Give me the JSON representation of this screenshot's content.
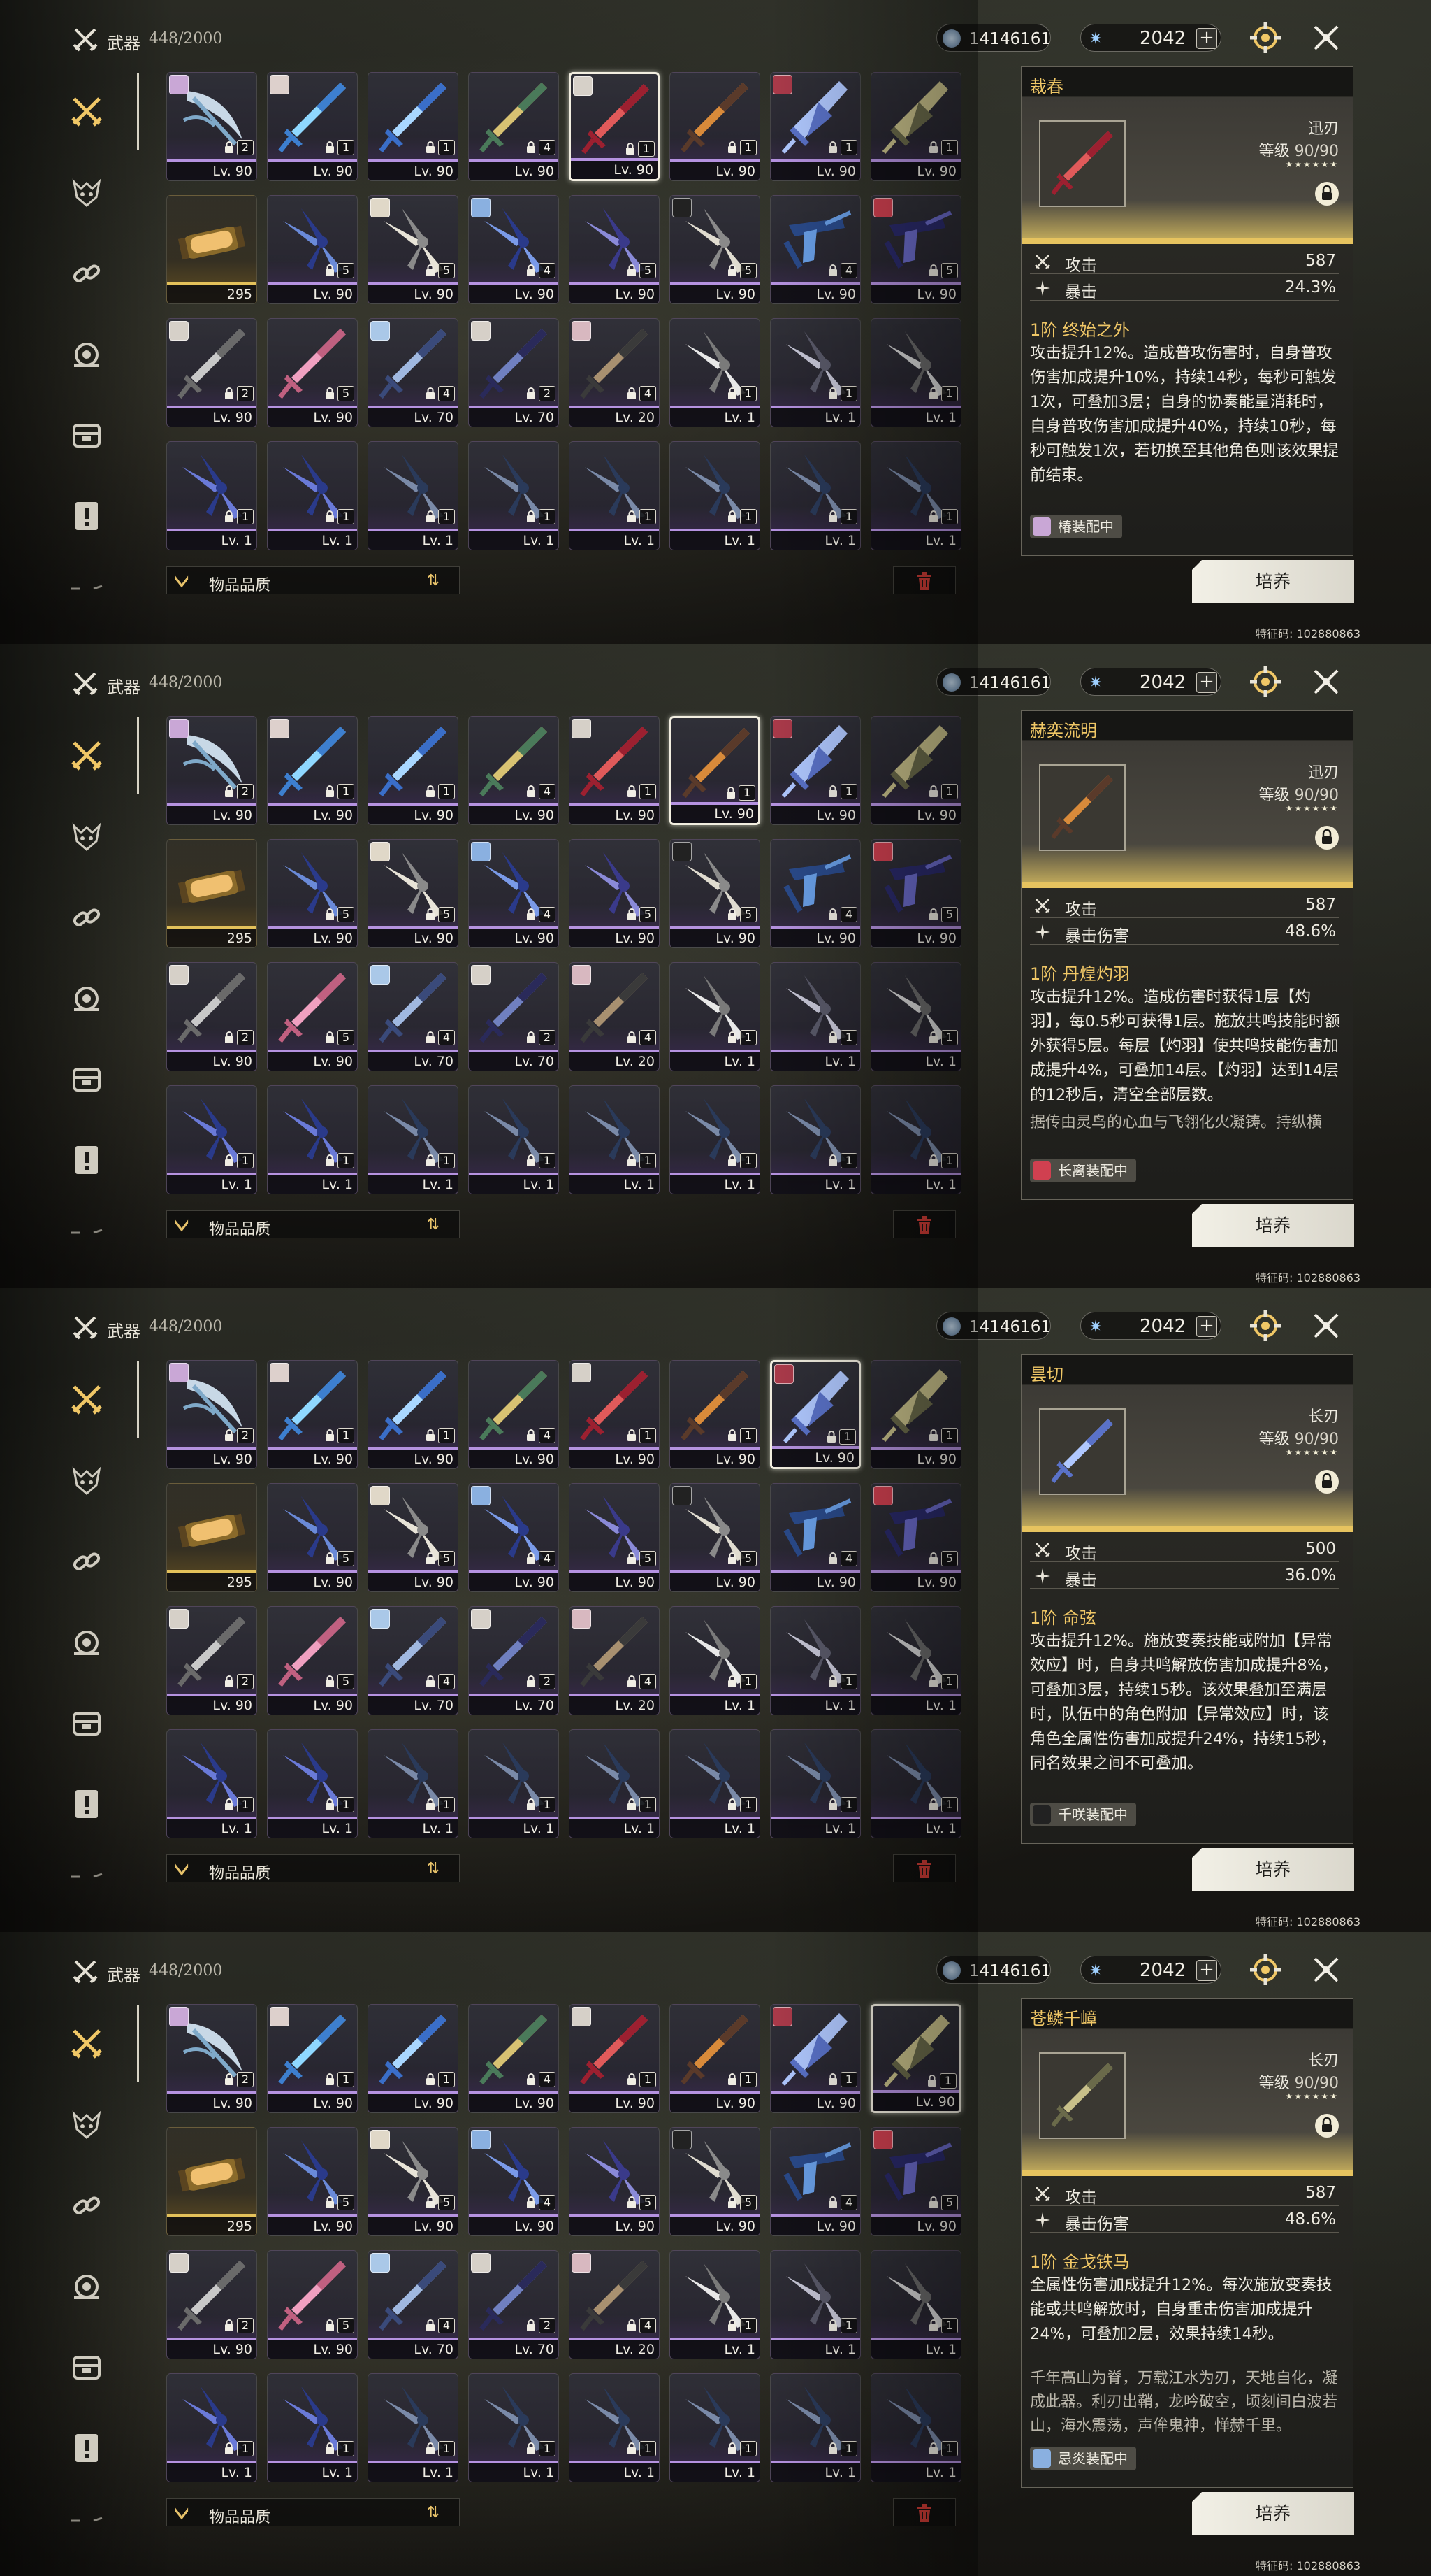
{
  "header": {
    "title": "武器",
    "count": "448/2000",
    "currency_1": "14146161",
    "currency_2": "2042",
    "plus_label": "+"
  },
  "icons": {
    "header": "crossed-swords-icon",
    "gear": "gear-icon",
    "close": "close-icon",
    "sidebar": [
      "crossed-swords-icon",
      "echo-mask-icon",
      "link-icon",
      "gear-cog-icon",
      "chest-icon",
      "document-icon",
      "more-icon"
    ]
  },
  "colors": {
    "gold_accent": "#f0c766",
    "purple_rarity": "#b592e0",
    "gold_rarity": "#e3c15a"
  },
  "footer": {
    "filter_label": "物品品质",
    "sort_label": "⇅",
    "cultivate_label": "培养",
    "feature_code": "特征码: 102880863"
  },
  "grid_rows": [
    [
      {
        "lv": "Lv. 90",
        "rank": "2",
        "avatar": "#c9a7d6",
        "c1": "#7fa9c9",
        "c2": "#c8d8e6",
        "shape": "crescent"
      },
      {
        "lv": "Lv. 90",
        "rank": "1",
        "avatar": "#ddd0cc",
        "c1": "#3d7fcf",
        "c2": "#8fd8ff",
        "shape": "sword"
      },
      {
        "lv": "Lv. 90",
        "rank": "1",
        "avatar": "",
        "c1": "#3a6ec8",
        "c2": "#a9d7ff",
        "shape": "sword"
      },
      {
        "lv": "Lv. 90",
        "rank": "4",
        "avatar": "",
        "c1": "#4a7a5a",
        "c2": "#d8c272",
        "shape": "sword"
      },
      {
        "lv": "Lv. 90",
        "rank": "1",
        "avatar": "#d6d0c8",
        "c1": "#9c2030",
        "c2": "#e05a5a",
        "shape": "sword"
      },
      {
        "lv": "Lv. 90",
        "rank": "1",
        "avatar": "",
        "c1": "#5a3a2a",
        "c2": "#d88a3a",
        "shape": "sword"
      },
      {
        "lv": "Lv. 90",
        "rank": "1",
        "avatar": "#aa3a4a",
        "c1": "#5a72c8",
        "c2": "#b0c8ff",
        "shape": "blade"
      },
      {
        "lv": "Lv. 90",
        "rank": "1",
        "avatar": "",
        "c1": "#6a6a4a",
        "c2": "#c8c08a",
        "shape": "blade"
      }
    ],
    [
      {
        "lv": "295",
        "rank": "",
        "avatar": "",
        "c1": "#8a6a2a",
        "c2": "#f0c070",
        "shape": "tube",
        "gold": true
      },
      {
        "lv": "Lv. 90",
        "rank": "5",
        "avatar": "",
        "c1": "#2a3a8a",
        "c2": "#6a8ad8",
        "shape": "claw"
      },
      {
        "lv": "Lv. 90",
        "rank": "5",
        "avatar": "#e0d8c8",
        "c1": "#8a8a8a",
        "c2": "#e8e4d8",
        "shape": "claw"
      },
      {
        "lv": "Lv. 90",
        "rank": "4",
        "avatar": "#8ab0e0",
        "c1": "#2a3a8a",
        "c2": "#7a9ae8",
        "shape": "claw"
      },
      {
        "lv": "Lv. 90",
        "rank": "5",
        "avatar": "",
        "c1": "#3a3a8a",
        "c2": "#8a8ad8",
        "shape": "claw"
      },
      {
        "lv": "Lv. 90",
        "rank": "5",
        "avatar": "#222222",
        "c1": "#8a8a8a",
        "c2": "#e0dcd0",
        "shape": "claw"
      },
      {
        "lv": "Lv. 90",
        "rank": "4",
        "avatar": "",
        "c1": "#2a4a8a",
        "c2": "#6aa0e8",
        "shape": "gun"
      },
      {
        "lv": "Lv. 90",
        "rank": "5",
        "avatar": "#d04050",
        "c1": "#2a2a6a",
        "c2": "#6a6ac8",
        "shape": "gun"
      }
    ],
    [
      {
        "lv": "Lv. 90",
        "rank": "2",
        "avatar": "#d6d0c8",
        "c1": "#6a6a6a",
        "c2": "#c8c8c8",
        "shape": "sword"
      },
      {
        "lv": "Lv. 90",
        "rank": "5",
        "avatar": "",
        "c1": "#c06080",
        "c2": "#f0a0c0",
        "shape": "sword"
      },
      {
        "lv": "Lv. 70",
        "rank": "4",
        "avatar": "#aac8e8",
        "c1": "#3a4a7a",
        "c2": "#a0b8e0",
        "shape": "sword"
      },
      {
        "lv": "Lv. 70",
        "rank": "2",
        "avatar": "#d6d0c8",
        "c1": "#2a2a5a",
        "c2": "#7080c0",
        "shape": "sword"
      },
      {
        "lv": "Lv. 20",
        "rank": "4",
        "avatar": "#d8b8c0",
        "c1": "#3a3a3a",
        "c2": "#a89070",
        "shape": "sword"
      },
      {
        "lv": "Lv. 1",
        "rank": "1",
        "avatar": "",
        "c1": "#7a7a7a",
        "c2": "#e8e8e8",
        "shape": "claw"
      },
      {
        "lv": "Lv. 1",
        "rank": "1",
        "avatar": "",
        "c1": "#5a5a6a",
        "c2": "#c8c8d8",
        "shape": "claw"
      },
      {
        "lv": "Lv. 1",
        "rank": "1",
        "avatar": "",
        "c1": "#6a6a6a",
        "c2": "#d8d8d8",
        "shape": "claw"
      }
    ],
    [
      {
        "lv": "Lv. 1",
        "rank": "1",
        "avatar": "",
        "c1": "#2a3a8a",
        "c2": "#6a7ad8",
        "shape": "claw"
      },
      {
        "lv": "Lv. 1",
        "rank": "1",
        "avatar": "",
        "c1": "#2a3a8a",
        "c2": "#6a7ad8",
        "shape": "claw"
      },
      {
        "lv": "Lv. 1",
        "rank": "1",
        "avatar": "",
        "c1": "#2a3a5a",
        "c2": "#7a8aa8",
        "shape": "claw"
      },
      {
        "lv": "Lv. 1",
        "rank": "1",
        "avatar": "",
        "c1": "#2a3a5a",
        "c2": "#7a8aa8",
        "shape": "claw"
      },
      {
        "lv": "Lv. 1",
        "rank": "1",
        "avatar": "",
        "c1": "#2a3a5a",
        "c2": "#7a8aa8",
        "shape": "claw"
      },
      {
        "lv": "Lv. 1",
        "rank": "1",
        "avatar": "",
        "c1": "#2a3a5a",
        "c2": "#7a8aa8",
        "shape": "claw"
      },
      {
        "lv": "Lv. 1",
        "rank": "1",
        "avatar": "",
        "c1": "#2a3a5a",
        "c2": "#7a8aa8",
        "shape": "claw"
      },
      {
        "lv": "Lv. 1",
        "rank": "1",
        "avatar": "",
        "c1": "#2a3a5a",
        "c2": "#7a8aa8",
        "shape": "claw"
      }
    ]
  ],
  "panels": [
    {
      "selected_col": 4,
      "name": "裁春",
      "type": "迅刃",
      "level_label": "等级",
      "level": "90/90",
      "stars": "★★★★★★",
      "stat1_name": "攻击",
      "stat1_value": "587",
      "stat2_name": "暴击",
      "stat2_value": "24.3%",
      "skill_title": "1阶 终始之外",
      "skill_desc": "攻击提升12%。造成普攻伤害时，自身普攻伤害加成提升10%，持续14秒，每秒可触发1次，可叠加3层；自身的协奏能量消耗时，自身普攻伤害加成提升40%，持续10秒，每秒可触发1次，若切换至其他角色则该效果提前结束。",
      "lore": "",
      "equipped": "椿装配中",
      "equip_avatar": "#c9a7d6",
      "thumb_c1": "#9c2030",
      "thumb_c2": "#e05a5a"
    },
    {
      "selected_col": 5,
      "name": "赫奕流明",
      "type": "迅刃",
      "level_label": "等级",
      "level": "90/90",
      "stars": "★★★★★★",
      "stat1_name": "攻击",
      "stat1_value": "587",
      "stat2_name": "暴击伤害",
      "stat2_value": "48.6%",
      "skill_title": "1阶 丹煌灼羽",
      "skill_desc": "攻击提升12%。造成伤害时获得1层【灼羽】，每0.5秒可获得1层。施放共鸣技能时额外获得5层。每层【灼羽】使共鸣技能伤害加成提升4%，可叠加14层。【灼羽】达到14层的12秒后，清空全部层数。",
      "lore": "据传由灵鸟的心血与飞翎化火凝铸。持纵横",
      "equipped": "长离装配中",
      "equip_avatar": "#d04050",
      "thumb_c1": "#5a3a2a",
      "thumb_c2": "#d88a3a"
    },
    {
      "selected_col": 6,
      "name": "昙切",
      "type": "长刃",
      "level_label": "等级",
      "level": "90/90",
      "stars": "★★★★★★",
      "stat1_name": "攻击",
      "stat1_value": "500",
      "stat2_name": "暴击",
      "stat2_value": "36.0%",
      "skill_title": "1阶 命弦",
      "skill_desc": "攻击提升12%。施放变奏技能或附加【异常效应】时，自身共鸣解放伤害加成提升8%，可叠加3层，持续15秒。该效果叠加至满层时，队伍中的角色附加【异常效应】时，该角色全属性伤害加成提升24%，持续15秒，同名效果之间不可叠加。",
      "lore": "",
      "equipped": "千咲装配中",
      "equip_avatar": "#222222",
      "thumb_c1": "#5a72c8",
      "thumb_c2": "#b0c8ff"
    },
    {
      "selected_col": 7,
      "name": "苍鳞千嶂",
      "type": "长刃",
      "level_label": "等级",
      "level": "90/90",
      "stars": "★★★★★★",
      "stat1_name": "攻击",
      "stat1_value": "587",
      "stat2_name": "暴击伤害",
      "stat2_value": "48.6%",
      "skill_title": "1阶 金戈铁马",
      "skill_desc": "全属性伤害加成提升12%。每次施放变奏技能或共鸣解放时，自身重击伤害加成提升24%，可叠加2层，效果持续14秒。",
      "lore": "千年高山为脊，万载江水为刃，天地自化，凝成此器。利刃出鞘，龙吟破空，顷刻间白波若山，海水震荡，声侔鬼神，惮赫千里。",
      "equipped": "忌炎装配中",
      "equip_avatar": "#8ab0e0",
      "thumb_c1": "#6a6a4a",
      "thumb_c2": "#c8c08a"
    }
  ]
}
